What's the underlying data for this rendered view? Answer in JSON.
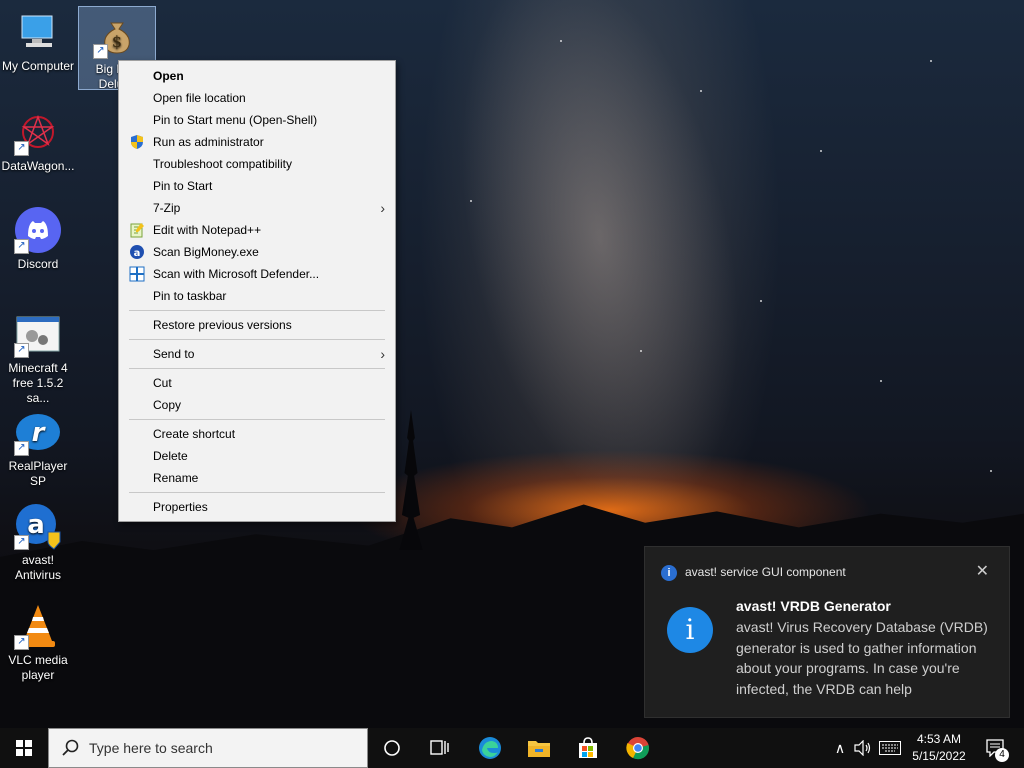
{
  "desktop": {
    "icons": [
      {
        "label": "My Computer",
        "icon": "computer-icon"
      },
      {
        "label": "Big M… Delu…",
        "icon": "money-bag-icon"
      },
      {
        "label": "DataWagon...",
        "icon": "datawagon-icon"
      },
      {
        "label": "Discord",
        "icon": "discord-icon"
      },
      {
        "label": "Minecraft 4 free 1.5.2 sa...",
        "icon": "minecraft-installer-icon"
      },
      {
        "label": "RealPlayer SP",
        "icon": "realplayer-icon"
      },
      {
        "label": "avast! Antivirus",
        "icon": "avast-icon"
      },
      {
        "label": "VLC media player",
        "icon": "vlc-icon"
      }
    ],
    "shortcut_glyph": "↗"
  },
  "context_menu": {
    "items": [
      {
        "label": "Open",
        "bold": true
      },
      {
        "label": "Open file location"
      },
      {
        "label": "Pin to Start menu (Open-Shell)"
      },
      {
        "label": "Run as administrator",
        "icon": "uac-shield-icon"
      },
      {
        "label": "Troubleshoot compatibility"
      },
      {
        "label": "Pin to Start"
      },
      {
        "label": "7-Zip",
        "submenu": true
      },
      {
        "label": "Edit with Notepad++",
        "icon": "notepadpp-icon"
      },
      {
        "label": "Scan BigMoney.exe",
        "icon": "avast-scan-icon"
      },
      {
        "label": "Scan with Microsoft Defender...",
        "icon": "defender-icon"
      },
      {
        "label": "Pin to taskbar"
      },
      {
        "label": "Restore previous versions"
      },
      {
        "label": "Send to",
        "submenu": true
      },
      {
        "label": "Cut"
      },
      {
        "label": "Copy"
      },
      {
        "label": "Create shortcut"
      },
      {
        "label": "Delete"
      },
      {
        "label": "Rename"
      },
      {
        "label": "Properties"
      }
    ],
    "submenu_arrow": "›"
  },
  "notification": {
    "app_name": "avast! service GUI component",
    "app_icon_glyph": "i",
    "close_glyph": "✕",
    "big_icon_glyph": "i",
    "title": "avast! VRDB Generator",
    "body": "avast! Virus Recovery Database (VRDB) generator is used to gather information about your programs. In case you're infected, the VRDB can help"
  },
  "taskbar": {
    "search_placeholder": "Type here to search",
    "pinned": [
      "cortana-icon",
      "task-view-icon",
      "edge-icon",
      "file-explorer-icon",
      "store-icon",
      "chrome-icon"
    ],
    "tray": {
      "chevron_glyph": "∧",
      "time": "4:53 AM",
      "date": "5/15/2022",
      "notification_count": "4"
    }
  },
  "colors": {
    "menu_bg": "#f2f2f2",
    "toast_bg": "#1f1f1f",
    "taskbar_bg": "#101010",
    "accent": "#1e88e5"
  }
}
